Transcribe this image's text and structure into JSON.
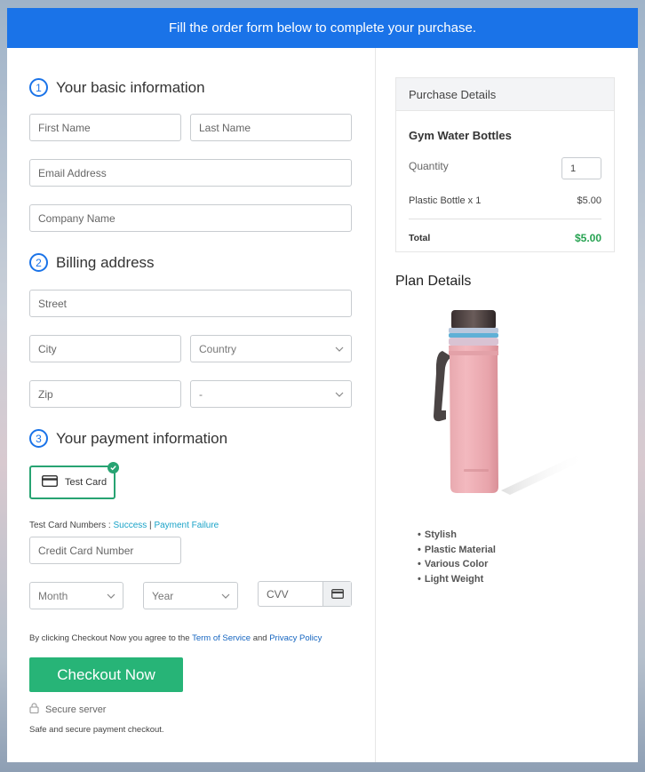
{
  "banner": {
    "text": "Fill the order form below to complete your purchase."
  },
  "basic": {
    "step": "1",
    "title": "Your basic information",
    "first_name": "First Name",
    "last_name": "Last Name",
    "email": "Email Address",
    "company": "Company Name"
  },
  "billing": {
    "step": "2",
    "title": "Billing address",
    "street": "Street",
    "city": "City",
    "country": "Country",
    "zip": "Zip",
    "state": "-"
  },
  "payment": {
    "step": "3",
    "title": "Your payment information",
    "test_card_label": "Test Card",
    "test_numbers_prefix": "Test Card Numbers : ",
    "success_link": "Success",
    "separator": " | ",
    "failure_link": "Payment Failure",
    "card_number": "Credit Card Number",
    "month": "Month",
    "year": "Year",
    "cvv": "CVV"
  },
  "terms": {
    "prefix": "By clicking Checkout Now you agree to the ",
    "tos": "Term of Service",
    "and": " and ",
    "privacy": "Privacy Policy"
  },
  "checkout": {
    "button": "Checkout Now",
    "secure": "Secure server",
    "note": "Safe and secure payment checkout."
  },
  "purchase": {
    "header": "Purchase Details",
    "product": "Gym Water Bottles",
    "quantity_label": "Quantity",
    "quantity_value": "1",
    "line_item": "Plastic Bottle x 1",
    "line_price": "$5.00",
    "total_label": "Total",
    "total_value": "$5.00"
  },
  "plan": {
    "title": "Plan Details",
    "features": [
      "Stylish",
      "Plastic Material",
      "Various Color",
      "Light Weight"
    ]
  },
  "colors": {
    "brand": "#1a73e8",
    "success": "#27b477",
    "total_green": "#27a352"
  }
}
